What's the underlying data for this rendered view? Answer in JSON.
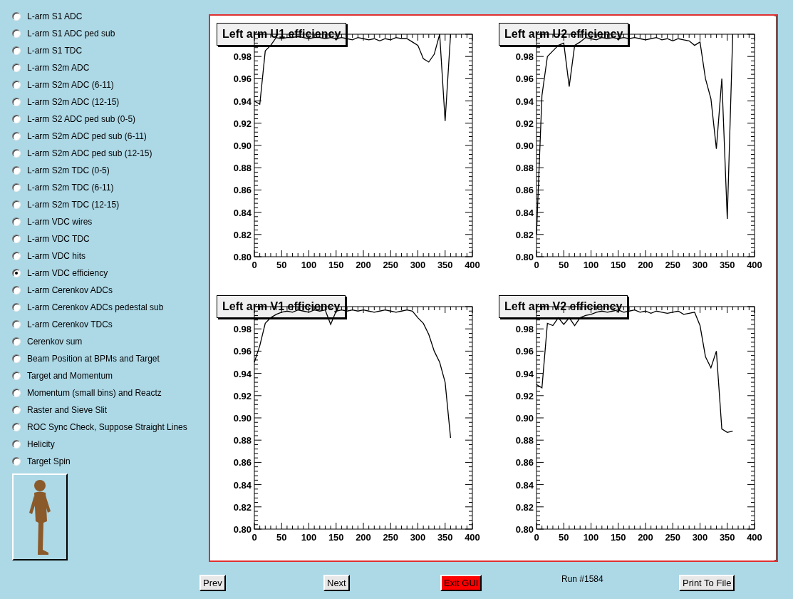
{
  "options": [
    {
      "label": "L-arm S1 ADC",
      "selected": false
    },
    {
      "label": "L-arm S1 ADC ped sub",
      "selected": false
    },
    {
      "label": "L-arm S1 TDC",
      "selected": false
    },
    {
      "label": "L-arm S2m ADC",
      "selected": false
    },
    {
      "label": "L-arm S2m ADC (6-11)",
      "selected": false
    },
    {
      "label": "L-arm S2m ADC (12-15)",
      "selected": false
    },
    {
      "label": "L-arm S2 ADC ped sub (0-5)",
      "selected": false
    },
    {
      "label": "L-arm S2m ADC ped sub (6-11)",
      "selected": false
    },
    {
      "label": "L-arm S2m ADC ped sub (12-15)",
      "selected": false
    },
    {
      "label": "L-arm S2m TDC (0-5)",
      "selected": false
    },
    {
      "label": "L-arm S2m TDC (6-11)",
      "selected": false
    },
    {
      "label": "L-arm S2m TDC (12-15)",
      "selected": false
    },
    {
      "label": "L-arm VDC wires",
      "selected": false
    },
    {
      "label": "L-arm VDC TDC",
      "selected": false
    },
    {
      "label": "L-arm VDC hits",
      "selected": false
    },
    {
      "label": "L-arm VDC efficiency",
      "selected": true
    },
    {
      "label": "L-arm Cerenkov ADCs",
      "selected": false
    },
    {
      "label": "L-arm Cerenkov ADCs pedestal sub",
      "selected": false
    },
    {
      "label": "L-arm Cerenkov TDCs",
      "selected": false
    },
    {
      "label": "Cerenkov sum",
      "selected": false
    },
    {
      "label": "Beam Position at BPMs and Target",
      "selected": false
    },
    {
      "label": "Target and Momentum",
      "selected": false
    },
    {
      "label": "Momentum (small bins) and Reactz",
      "selected": false
    },
    {
      "label": "Raster and Sieve Slit",
      "selected": false
    },
    {
      "label": "ROC Sync Check, Suppose Straight Lines",
      "selected": false
    },
    {
      "label": "Helicity",
      "selected": false
    },
    {
      "label": "Target Spin",
      "selected": false
    }
  ],
  "charts": [
    {
      "chart_data": {
        "type": "line",
        "title": "Left arm U1 efficiency",
        "x": [
          0,
          10,
          20,
          30,
          40,
          50,
          60,
          70,
          80,
          90,
          100,
          110,
          120,
          130,
          140,
          150,
          160,
          170,
          180,
          190,
          200,
          210,
          220,
          230,
          240,
          250,
          260,
          270,
          280,
          290,
          300,
          310,
          320,
          330,
          340,
          350,
          360
        ],
        "values": [
          0.94,
          0.937,
          0.985,
          0.99,
          0.997,
          0.996,
          0.997,
          0.997,
          0.998,
          0.997,
          0.996,
          0.997,
          0.997,
          0.996,
          0.997,
          0.996,
          0.997,
          0.996,
          0.995,
          0.997,
          0.996,
          0.995,
          0.996,
          0.994,
          0.996,
          0.995,
          0.997,
          0.996,
          0.996,
          0.993,
          0.99,
          0.978,
          0.975,
          0.982,
          1.0,
          0.922,
          1.0
        ],
        "xlim": [
          0,
          400
        ],
        "ylim": [
          0.8,
          1.0
        ],
        "xticks": [
          0,
          50,
          100,
          150,
          200,
          250,
          300,
          350,
          400
        ],
        "yticks": [
          {
            "value": 0.8,
            "label": "0.80"
          },
          {
            "value": 0.82,
            "label": "0.82"
          },
          {
            "value": 0.84,
            "label": "0.84"
          },
          {
            "value": 0.86,
            "label": "0.86"
          },
          {
            "value": 0.88,
            "label": "0.88"
          },
          {
            "value": 0.9,
            "label": "0.90"
          },
          {
            "value": 0.92,
            "label": "0.92"
          },
          {
            "value": 0.94,
            "label": "0.94"
          },
          {
            "value": 0.96,
            "label": "0.96"
          },
          {
            "value": 0.98,
            "label": "0.98"
          }
        ]
      }
    },
    {
      "chart_data": {
        "type": "line",
        "title": "Left arm U2 efficiency",
        "x": [
          0,
          10,
          20,
          30,
          40,
          50,
          60,
          70,
          80,
          90,
          100,
          110,
          120,
          130,
          140,
          150,
          160,
          170,
          180,
          190,
          200,
          210,
          220,
          230,
          240,
          250,
          260,
          270,
          280,
          290,
          300,
          310,
          320,
          330,
          340,
          350,
          360
        ],
        "values": [
          0.82,
          0.945,
          0.98,
          0.985,
          0.99,
          0.992,
          0.953,
          0.99,
          0.993,
          0.997,
          0.996,
          0.995,
          0.997,
          0.996,
          0.997,
          0.996,
          0.997,
          0.996,
          0.997,
          0.996,
          0.995,
          0.996,
          0.997,
          0.995,
          0.996,
          0.994,
          0.996,
          0.995,
          0.994,
          0.99,
          0.993,
          0.96,
          0.942,
          0.897,
          0.96,
          0.834,
          1.0
        ],
        "xlim": [
          0,
          400
        ],
        "ylim": [
          0.8,
          1.0
        ],
        "xticks": [
          0,
          50,
          100,
          150,
          200,
          250,
          300,
          350,
          400
        ],
        "yticks": [
          {
            "value": 0.8,
            "label": "0.80"
          },
          {
            "value": 0.82,
            "label": "0.82"
          },
          {
            "value": 0.84,
            "label": "0.84"
          },
          {
            "value": 0.86,
            "label": "0.86"
          },
          {
            "value": 0.88,
            "label": "0.88"
          },
          {
            "value": 0.9,
            "label": "0.90"
          },
          {
            "value": 0.92,
            "label": "0.92"
          },
          {
            "value": 0.94,
            "label": "0.94"
          },
          {
            "value": 0.96,
            "label": "0.96"
          },
          {
            "value": 0.98,
            "label": "0.98"
          }
        ]
      }
    },
    {
      "chart_data": {
        "type": "line",
        "title": "Left arm V1 efficiency",
        "x": [
          0,
          10,
          20,
          30,
          40,
          50,
          60,
          70,
          80,
          90,
          100,
          110,
          120,
          130,
          140,
          150,
          160,
          170,
          180,
          190,
          200,
          210,
          220,
          230,
          240,
          250,
          260,
          270,
          280,
          290,
          300,
          310,
          320,
          330,
          340,
          350,
          360
        ],
        "values": [
          0.95,
          0.965,
          0.985,
          0.99,
          0.993,
          0.995,
          0.996,
          0.995,
          0.997,
          0.996,
          0.995,
          0.997,
          0.996,
          0.997,
          0.984,
          0.996,
          0.997,
          0.996,
          0.997,
          0.996,
          0.997,
          0.996,
          0.995,
          0.996,
          0.997,
          0.996,
          0.995,
          0.996,
          0.997,
          0.996,
          0.99,
          0.985,
          0.975,
          0.96,
          0.95,
          0.932,
          0.882
        ],
        "xlim": [
          0,
          400
        ],
        "ylim": [
          0.8,
          1.0
        ],
        "xticks": [
          0,
          50,
          100,
          150,
          200,
          250,
          300,
          350,
          400
        ],
        "yticks": [
          {
            "value": 0.8,
            "label": "0.80"
          },
          {
            "value": 0.82,
            "label": "0.82"
          },
          {
            "value": 0.84,
            "label": "0.84"
          },
          {
            "value": 0.86,
            "label": "0.86"
          },
          {
            "value": 0.88,
            "label": "0.88"
          },
          {
            "value": 0.9,
            "label": "0.90"
          },
          {
            "value": 0.92,
            "label": "0.92"
          },
          {
            "value": 0.94,
            "label": "0.94"
          },
          {
            "value": 0.96,
            "label": "0.96"
          },
          {
            "value": 0.98,
            "label": "0.98"
          }
        ]
      }
    },
    {
      "chart_data": {
        "type": "line",
        "title": "Left arm V2 efficiency",
        "x": [
          0,
          10,
          20,
          30,
          40,
          50,
          60,
          70,
          80,
          90,
          100,
          110,
          120,
          130,
          140,
          150,
          160,
          170,
          180,
          190,
          200,
          210,
          220,
          230,
          240,
          250,
          260,
          270,
          280,
          290,
          300,
          310,
          320,
          330,
          340,
          350,
          360
        ],
        "values": [
          0.93,
          0.927,
          0.985,
          0.983,
          0.99,
          0.984,
          0.99,
          0.983,
          0.99,
          0.992,
          0.993,
          0.995,
          0.996,
          0.995,
          0.996,
          0.997,
          0.995,
          0.996,
          0.997,
          0.995,
          0.996,
          0.994,
          0.996,
          0.995,
          0.994,
          0.995,
          0.996,
          0.993,
          0.994,
          0.995,
          0.983,
          0.955,
          0.945,
          0.96,
          0.89,
          0.887,
          0.888
        ],
        "xlim": [
          0,
          400
        ],
        "ylim": [
          0.8,
          1.0
        ],
        "xticks": [
          0,
          50,
          100,
          150,
          200,
          250,
          300,
          350,
          400
        ],
        "yticks": [
          {
            "value": 0.8,
            "label": "0.80"
          },
          {
            "value": 0.82,
            "label": "0.82"
          },
          {
            "value": 0.84,
            "label": "0.84"
          },
          {
            "value": 0.86,
            "label": "0.86"
          },
          {
            "value": 0.88,
            "label": "0.88"
          },
          {
            "value": 0.9,
            "label": "0.90"
          },
          {
            "value": 0.92,
            "label": "0.92"
          },
          {
            "value": 0.94,
            "label": "0.94"
          },
          {
            "value": 0.96,
            "label": "0.96"
          },
          {
            "value": 0.98,
            "label": "0.98"
          }
        ]
      }
    }
  ],
  "buttons": [
    {
      "label": "Prev",
      "kind": "plain"
    },
    {
      "label": "Next",
      "kind": "plain"
    },
    {
      "label": "Exit GUI",
      "kind": "danger"
    },
    {
      "label": "Run #1584",
      "kind": "text"
    },
    {
      "label": "Print To File",
      "kind": "plain"
    }
  ]
}
